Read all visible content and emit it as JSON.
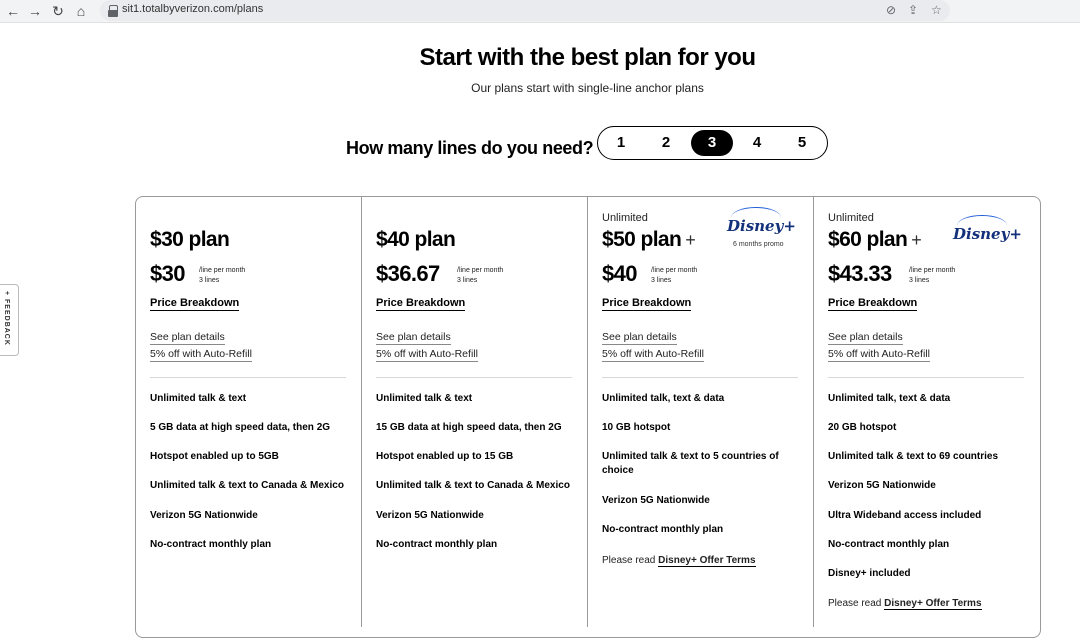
{
  "browser": {
    "url": "sit1.totalbyverizon.com/plans"
  },
  "header": {
    "title": "Start with the best plan for you",
    "subtitle": "Our plans start with single-line anchor plans"
  },
  "lines": {
    "question": "How many lines do you need?",
    "options": [
      "1",
      "2",
      "3",
      "4",
      "5"
    ],
    "selected": "3"
  },
  "feedback_label": "+ FEEDBACK",
  "plans": [
    {
      "kicker": "",
      "name": "$30 plan",
      "price": "$30",
      "price_unit": "/line per month",
      "price_lines": "3 lines",
      "breakdown": "Price Breakdown",
      "details_link": "See plan details",
      "autorefill_link": "5% off with Auto-Refill",
      "features": [
        "Unlimited talk & text",
        "5 GB data at high speed data, then 2G",
        "Hotspot enabled up to 5GB",
        "Unlimited talk & text to Canada & Mexico",
        "Verizon 5G Nationwide",
        "No-contract monthly plan"
      ]
    },
    {
      "kicker": "",
      "name": "$40 plan",
      "price": "$36.67",
      "price_unit": "/line per month",
      "price_lines": "3 lines",
      "breakdown": "Price Breakdown",
      "details_link": "See plan details",
      "autorefill_link": "5% off with Auto-Refill",
      "features": [
        "Unlimited talk & text",
        "15 GB data at high speed data, then 2G",
        "Hotspot enabled up to 15 GB",
        "Unlimited talk & text to Canada & Mexico",
        "Verizon 5G Nationwide",
        "No-contract monthly plan"
      ]
    },
    {
      "kicker": "Unlimited",
      "name": "$50 plan",
      "plus": "+",
      "logo": "Disney+",
      "logo_sub": "6 months promo",
      "price": "$40",
      "price_unit": "/line per month",
      "price_lines": "3 lines",
      "breakdown": "Price Breakdown",
      "details_link": "See plan details",
      "autorefill_link": "5% off with Auto-Refill",
      "features": [
        "Unlimited talk, text & data",
        "10 GB hotspot",
        "Unlimited talk & text to 5 countries of choice",
        "Verizon 5G Nationwide",
        "No-contract monthly plan"
      ],
      "terms_prefix": "Please read",
      "terms_link": "Disney+ Offer Terms"
    },
    {
      "kicker": "Unlimited",
      "name": "$60 plan",
      "plus": "+",
      "logo": "Disney+",
      "price": "$43.33",
      "price_unit": "/line per month",
      "price_lines": "3 lines",
      "breakdown": "Price Breakdown",
      "details_link": "See plan details",
      "autorefill_link": "5% off with Auto-Refill",
      "features": [
        "Unlimited talk, text & data",
        "20 GB hotspot",
        "Unlimited talk & text to 69 countries",
        "Verizon 5G Nationwide",
        "Ultra Wideband access included",
        "No-contract monthly plan",
        "Disney+ included"
      ],
      "terms_prefix": "Please read",
      "terms_link": "Disney+ Offer Terms"
    }
  ]
}
